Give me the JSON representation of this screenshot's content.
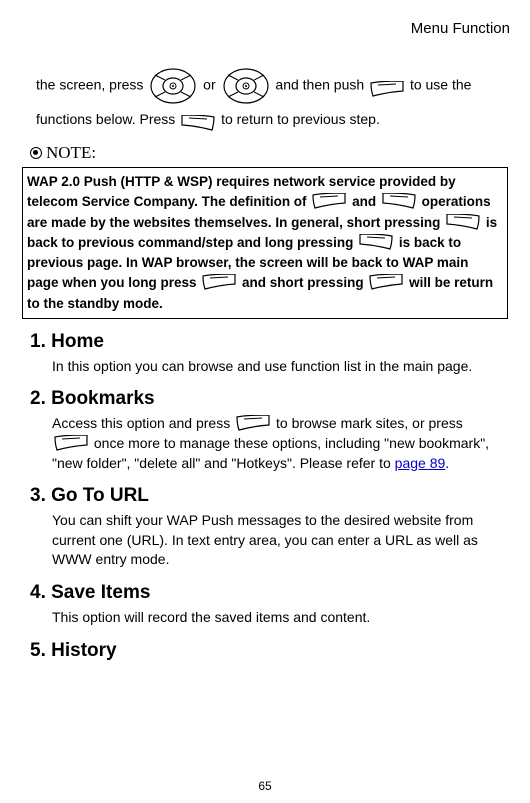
{
  "header": "Menu Function",
  "intro": {
    "t1": "the screen, press ",
    "t2": " or ",
    "t3": " and then push ",
    "t4": " to use the functions below. Press ",
    "t5": " to return to previous step."
  },
  "noteLabel": "NOTE:",
  "note": {
    "t1": "WAP 2.0 Push (HTTP & WSP) requires network service provided by telecom Service Company. The definition of ",
    "t2": " and ",
    "t3": " operations are made by the websites themselves. In general, short pressing ",
    "t4": " is back to previous command/step and long pressing ",
    "t5": " is back to previous page. In WAP browser, the screen will be back to WAP main page when you long press ",
    "t6": " and short pressing ",
    "t7": " will be return to the standby mode."
  },
  "sections": {
    "s1": {
      "title": "1. Home",
      "body": "In this option you can browse and use function list in the main page."
    },
    "s2": {
      "title": "2. Bookmarks",
      "b1": "Access this option and press ",
      "b2": " to browse mark sites, or press ",
      "b3": " once more to manage these options, including \"new bookmark\", \"new folder\", \"delete all\" and \"Hotkeys\".    Please refer to ",
      "link": "page 89",
      "b4": "."
    },
    "s3": {
      "title": "3. Go To URL",
      "body": "You can shift your WAP Push messages to the desired website from current one (URL). In text entry area, you can enter a URL as well as WWW entry mode."
    },
    "s4": {
      "title": "4. Save Items",
      "body": "This option will record the saved items and content."
    },
    "s5": {
      "title": "5. History"
    }
  },
  "pageNum": "65"
}
